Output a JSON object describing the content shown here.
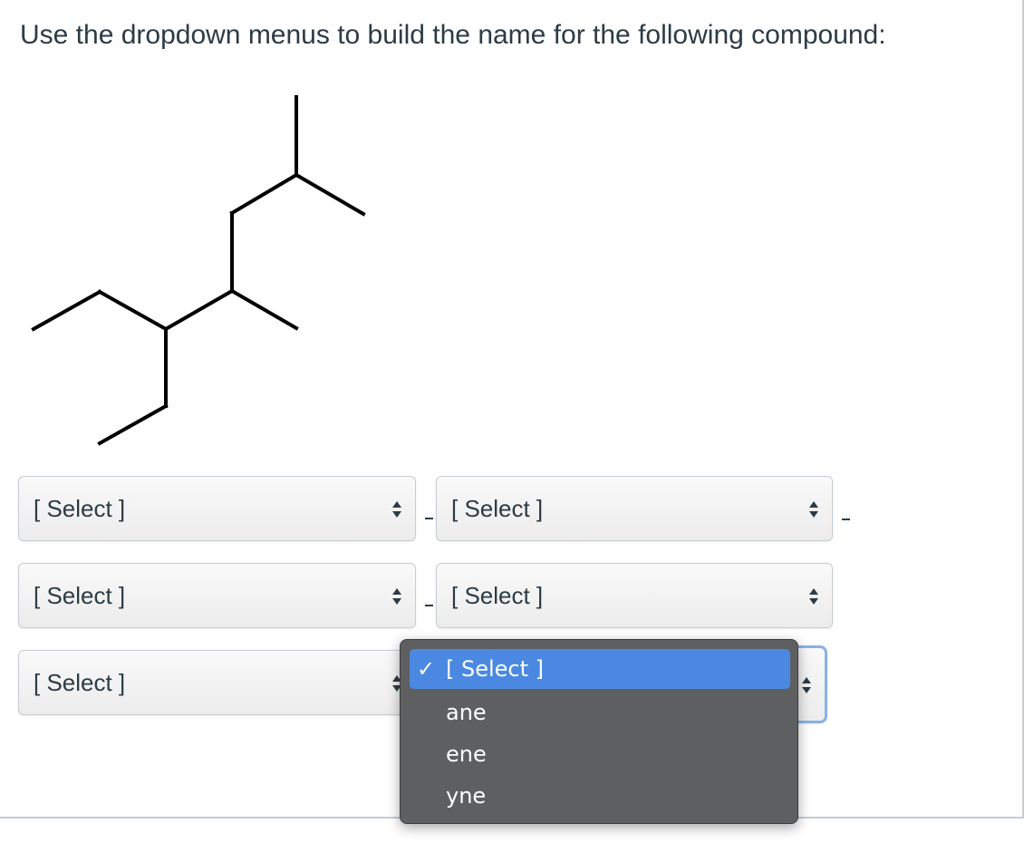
{
  "question": {
    "text": "Use the dropdown menus to build the name for the following compound:"
  },
  "dropdowns": [
    {
      "value": "[ Select ]"
    },
    {
      "value": "[ Select ]"
    },
    {
      "value": "[ Select ]"
    },
    {
      "value": "[ Select ]"
    },
    {
      "value": "[ Select ]"
    }
  ],
  "separators": [
    "-",
    "-",
    "-"
  ],
  "open_menu": {
    "check_icon": "✓",
    "options": [
      "[ Select ]",
      "ane",
      "ene",
      "yne"
    ],
    "selected_index": 0,
    "highlight_color": "#4a88e2"
  }
}
